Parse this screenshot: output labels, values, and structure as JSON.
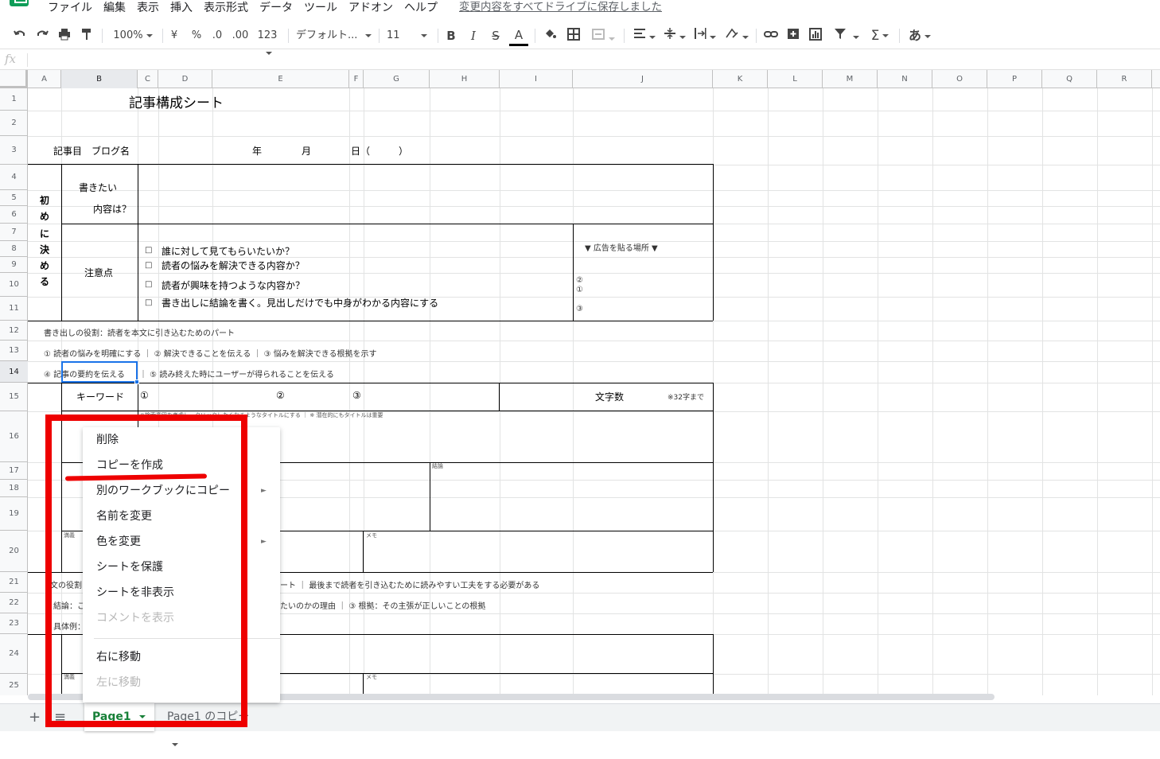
{
  "menubar": {
    "items": [
      "ファイル",
      "編集",
      "表示",
      "挿入",
      "表示形式",
      "データ",
      "ツール",
      "アドオン",
      "ヘルプ"
    ],
    "save_status": "変更内容をすべてドライブに保存しました"
  },
  "toolbar": {
    "zoom": "100%",
    "currency": "¥",
    "percent": "%",
    "decimal_decrease": ".0",
    "decimal_increase": ".00",
    "number_format": "123",
    "font": "デフォルト...",
    "font_size": "11",
    "bold": "B",
    "italic": "I",
    "strike": "S",
    "text_color": "A",
    "input_tools": "あ"
  },
  "formula_bar": {
    "fx": "fx"
  },
  "grid": {
    "columns": [
      "A",
      "B",
      "C",
      "D",
      "E",
      "F",
      "G",
      "H",
      "I",
      "J",
      "K",
      "L",
      "M",
      "N",
      "O",
      "P",
      "Q",
      "R"
    ],
    "rows": [
      "1",
      "2",
      "3",
      "4",
      "5",
      "6",
      "7",
      "8",
      "9",
      "10",
      "11",
      "12",
      "13",
      "14",
      "15",
      "16",
      "17",
      "18",
      "19",
      "20",
      "21",
      "22",
      "23",
      "24",
      "25"
    ],
    "cells": {
      "title": "記事構成シート",
      "r3_label": "記事目　ブログ名",
      "r3_year": "年",
      "r3_month": "月",
      "r3_day": "日（　　　）",
      "side_label_1": "初",
      "side_label_2": "め",
      "side_label_3": "に",
      "side_label_4": "決",
      "side_label_5": "め",
      "side_label_6": "る",
      "write_1": "書きたい",
      "write_2": "内容は？",
      "caution": "注意点",
      "check_1": "誰に対して見てもらいたいか？",
      "check_2": "読者の悩みを解決できる内容か？",
      "check_3": "読者が興味を持つような内容か？",
      "check_4": "書き出しに結論を書く。見出しだけでも中身がわかる内容にする",
      "checkbox": "□",
      "ad_label": "▼ 広告を貼る場所 ▼",
      "ad_2": "②",
      "ad_1": "①",
      "ad_3": "③",
      "r12": "書き出しの役割：読者を本文に引き込むためのパート",
      "r13": "① 読者の悩みを明確にする ｜ ② 解決できることを伝える ｜ ③ 悩みを解決できる根拠を示す",
      "r14_a": "④ 記事の要約を伝える",
      "r14_b": "｜ ⑤ 読み終えた時にユーザーが得られることを伝える",
      "keyword": "キーワード",
      "kw_1": "①",
      "kw_2": "②",
      "kw_3": "③",
      "char_count": "文字数",
      "char_limit": "※32字まで",
      "r16_note": "※検索意図を考慮し、クリックしたくなるようなタイトルにする ｜ ※ 潜在的にもタイトルは重要",
      "r17_note": "結論",
      "r20_left": "満義",
      "r20_memo": "メモ",
      "r21": "文の役割",
      "r21_right": "ート ｜ 最後まで読者を引き込むために読みやすい工夫をする必要がある",
      "r22_left": "結論：こ",
      "r22_right": "たいのかの理由 ｜ ③ 根拠：その主張が正しいことの根拠",
      "r23_left": "具体例：",
      "r25_left": "満義",
      "r25_memo": "メモ"
    }
  },
  "context_menu": {
    "items": [
      {
        "label": "削除",
        "enabled": true,
        "submenu": false
      },
      {
        "label": "コピーを作成",
        "enabled": true,
        "submenu": false
      },
      {
        "label": "別のワークブックにコピー",
        "enabled": true,
        "submenu": true
      },
      {
        "label": "名前を変更",
        "enabled": true,
        "submenu": false
      },
      {
        "label": "色を変更",
        "enabled": true,
        "submenu": true
      },
      {
        "label": "シートを保護",
        "enabled": true,
        "submenu": false
      },
      {
        "label": "シートを非表示",
        "enabled": true,
        "submenu": false
      },
      {
        "label": "コメントを表示",
        "enabled": false,
        "submenu": false
      },
      {
        "label": "右に移動",
        "enabled": true,
        "submenu": false
      },
      {
        "label": "左に移動",
        "enabled": false,
        "submenu": false
      }
    ],
    "submenu_arrow": "►"
  },
  "sheet_tabs": {
    "add": "+",
    "all_sheets": "≡",
    "tabs": [
      {
        "label": "Page1",
        "active": true
      },
      {
        "label": "Page1 のコピー",
        "active": false
      }
    ]
  },
  "colors": {
    "accent_green": "#188038",
    "selection_blue": "#1a73e8",
    "annotation_red": "#ee0000"
  }
}
